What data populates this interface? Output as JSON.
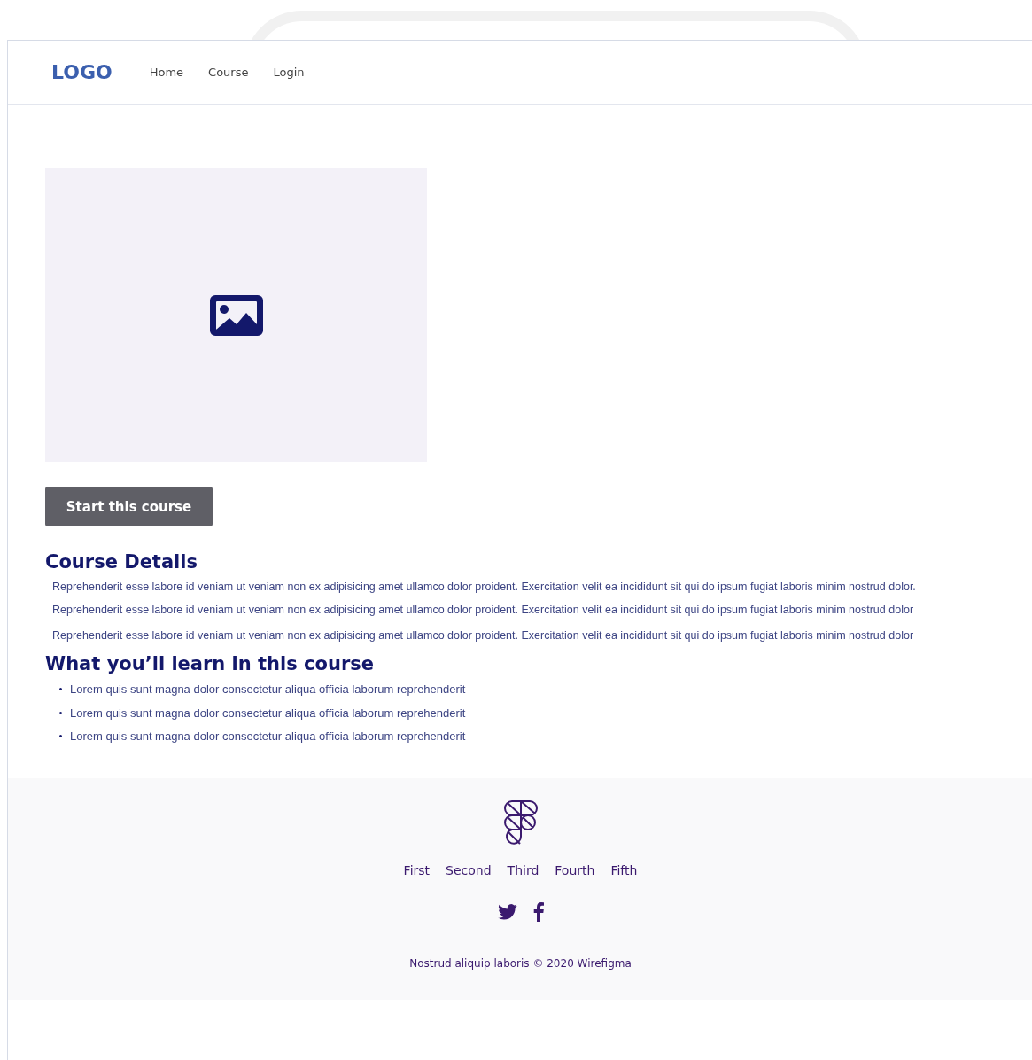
{
  "header": {
    "logo": "LOGO",
    "nav": [
      {
        "label": "Home"
      },
      {
        "label": "Course"
      },
      {
        "label": "Login"
      }
    ]
  },
  "course": {
    "image": {
      "kind": "picture"
    },
    "start_button": "Start this course",
    "details_title": "Course Details",
    "paragraphs": [
      "Reprehenderit esse labore id veniam ut veniam non ex adipisicing amet ullamco dolor proident. Exercitation velit ea incididunt sit qui do ipsum fugiat laboris minim nostrud dolor. Reprehenderit esse labore id veniam ut veniam non ex adipisicing amet ullamco dolor proident. Exercitation velit ea incididunt sit qui do ipsum fugiat laboris minim nostrud dolor",
      "Reprehenderit esse labore id veniam ut veniam non ex adipisicing amet ullamco dolor proident. Exercitation velit ea incididunt sit qui do ipsum fugiat laboris minim nostrud dolor"
    ],
    "learn_title": "What you’ll learn in this course",
    "learn_items": [
      "Lorem quis sunt magna dolor consectetur aliqua officia laborum reprehenderit",
      "Lorem quis sunt magna dolor consectetur aliqua officia laborum reprehenderit",
      "Lorem quis sunt magna dolor consectetur aliqua officia laborum reprehenderit"
    ]
  },
  "footer": {
    "links": [
      "First",
      "Second",
      "Third",
      "Fourth",
      "Fifth"
    ],
    "social": [
      {
        "kind": "twitter"
      },
      {
        "kind": "facebook"
      }
    ],
    "copyright": "Nostrud aliquip laboris © 2020 Wirefigma"
  }
}
